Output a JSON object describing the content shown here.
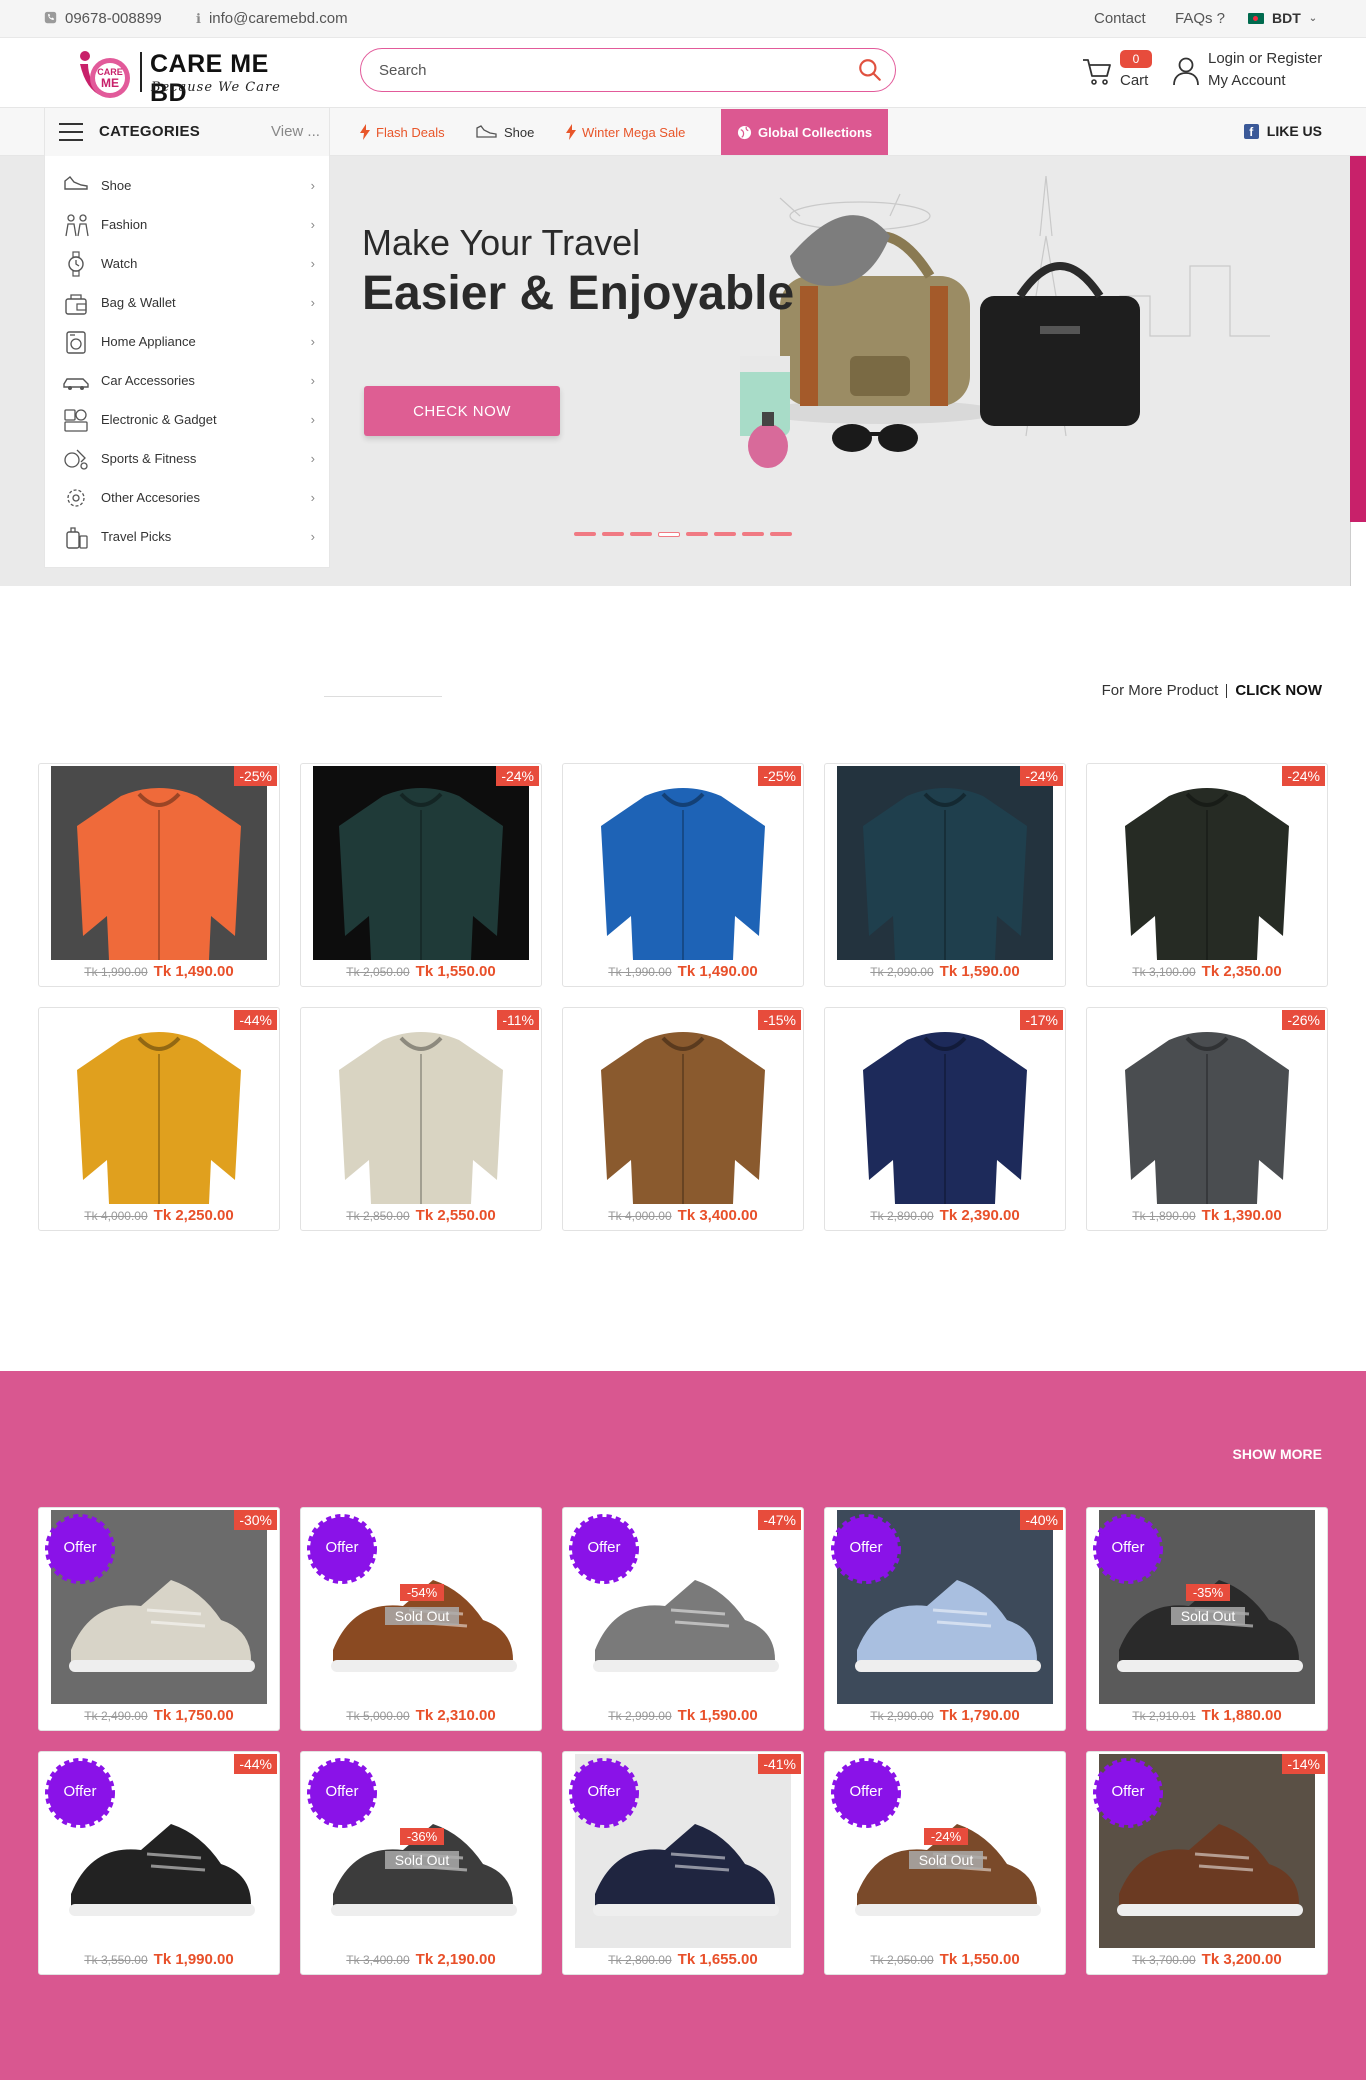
{
  "topbar": {
    "phone": "09678-008899",
    "email": "info@caremebd.com",
    "links": [
      "Contact",
      "FAQs ?"
    ],
    "currency": "BDT"
  },
  "header": {
    "logo_mark_text": "CARE ME",
    "logo_name": "CARE ME BD",
    "logo_tagline": "Because We Care",
    "search_placeholder": "Search",
    "cart_count": "0",
    "cart_label": "Cart",
    "account_line1": "Login or Register",
    "account_line2": "My Account",
    "accent": "#dc5891"
  },
  "nav": {
    "categories_title": "CATEGORIES",
    "view_label": "View ...",
    "links": [
      "Flash Deals",
      "Shoe",
      "Winter Mega Sale",
      "Global Collections"
    ],
    "like_us": "LIKE US"
  },
  "categories": [
    {
      "label": "Shoe",
      "icon": "shoe-icon"
    },
    {
      "label": "Fashion",
      "icon": "fashion-icon"
    },
    {
      "label": "Watch",
      "icon": "watch-icon"
    },
    {
      "label": "Bag & Wallet",
      "icon": "bag-icon"
    },
    {
      "label": "Home Appliance",
      "icon": "home-appliance-icon"
    },
    {
      "label": "Car Accessories",
      "icon": "car-icon"
    },
    {
      "label": "Electronic & Gadget",
      "icon": "gadget-icon"
    },
    {
      "label": "Sports & Fitness",
      "icon": "sports-icon"
    },
    {
      "label": "Other Accesories",
      "icon": "accessories-icon"
    },
    {
      "label": "Travel Picks",
      "icon": "travel-icon"
    }
  ],
  "hero": {
    "line1": "Make Your Travel",
    "line2": "Easier & Enjoyable",
    "cta": "CHECK NOW",
    "slide_count": 8,
    "active_slide": 4
  },
  "section1": {
    "more_text": "For More Product",
    "click_now": "CLICK NOW",
    "products": [
      {
        "discount": "-25%",
        "old": "Tk 1,990.00",
        "new": "Tk 1,490.00",
        "color": "#ef6a3a"
      },
      {
        "discount": "-24%",
        "old": "Tk 2,050.00",
        "new": "Tk 1,550.00",
        "color": "#1f3a38"
      },
      {
        "discount": "-25%",
        "old": "Tk 1,990.00",
        "new": "Tk 1,490.00",
        "color": "#1e63b6"
      },
      {
        "discount": "-24%",
        "old": "Tk 2,090.00",
        "new": "Tk 1,590.00",
        "color": "#1f3f4d"
      },
      {
        "discount": "-24%",
        "old": "Tk 3,100.00",
        "new": "Tk 2,350.00",
        "color": "#262b24"
      },
      {
        "discount": "-44%",
        "old": "Tk 4,000.00",
        "new": "Tk 2,250.00",
        "color": "#e0a01e"
      },
      {
        "discount": "-11%",
        "old": "Tk 2,850.00",
        "new": "Tk 2,550.00",
        "color": "#d9d4c2"
      },
      {
        "discount": "-15%",
        "old": "Tk 4,000.00",
        "new": "Tk 3,400.00",
        "color": "#8a5a2e"
      },
      {
        "discount": "-17%",
        "old": "Tk 2,890.00",
        "new": "Tk 2,390.00",
        "color": "#1d2a5a"
      },
      {
        "discount": "-26%",
        "old": "Tk 1,890.00",
        "new": "Tk 1,390.00",
        "color": "#4a4d50"
      }
    ]
  },
  "section2": {
    "show_more": "SHOW MORE",
    "offer_label": "Offer",
    "sold_out_label": "Sold Out",
    "products": [
      {
        "discount": "-30%",
        "old": "Tk 2,490.00",
        "new": "Tk 1,750.00",
        "sold_out": false,
        "color": "#d8d4c8"
      },
      {
        "discount": "-54%",
        "old": "Tk 5,000.00",
        "new": "Tk 2,310.00",
        "sold_out": true,
        "color": "#8a4a22"
      },
      {
        "discount": "-47%",
        "old": "Tk 2,999.00",
        "new": "Tk 1,590.00",
        "sold_out": false,
        "color": "#7a7a7a"
      },
      {
        "discount": "-40%",
        "old": "Tk 2,990.00",
        "new": "Tk 1,790.00",
        "sold_out": false,
        "color": "#a9bfe0"
      },
      {
        "discount": "-35%",
        "old": "Tk 2,910.01",
        "new": "Tk 1,880.00",
        "sold_out": true,
        "color": "#2a2a2a"
      },
      {
        "discount": "-44%",
        "old": "Tk 3,550.00",
        "new": "Tk 1,990.00",
        "sold_out": false,
        "color": "#222222"
      },
      {
        "discount": "-36%",
        "old": "Tk 3,400.00",
        "new": "Tk 2,190.00",
        "sold_out": true,
        "color": "#3c3c3c"
      },
      {
        "discount": "-41%",
        "old": "Tk 2,800.00",
        "new": "Tk 1,655.00",
        "sold_out": false,
        "color": "#1f2540"
      },
      {
        "discount": "-24%",
        "old": "Tk 2,050.00",
        "new": "Tk 1,550.00",
        "sold_out": true,
        "color": "#7a4a2a"
      },
      {
        "discount": "-14%",
        "old": "Tk 3,700.00",
        "new": "Tk 3,200.00",
        "sold_out": false,
        "color": "#6b3a22"
      }
    ]
  }
}
